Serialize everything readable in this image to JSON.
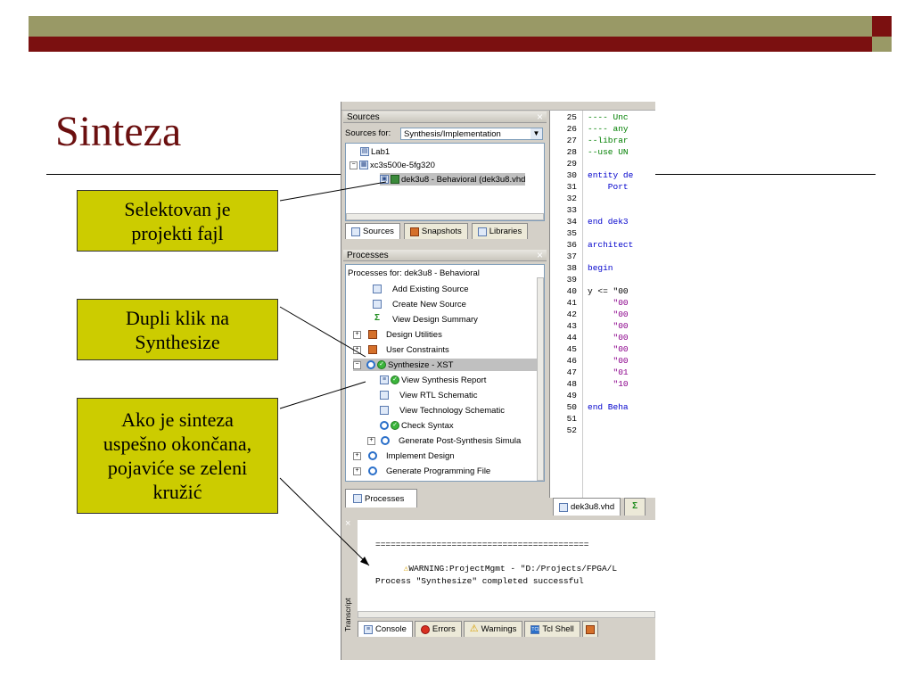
{
  "slide": {
    "title": "Sinteza",
    "callouts": [
      {
        "lines": [
          "Selektovan je",
          "projekti fajl"
        ]
      },
      {
        "lines": [
          "Dupli klik na",
          "Synthesize"
        ]
      },
      {
        "lines": [
          "Ako je sinteza",
          "uspešno okončana,",
          "pojaviće se zeleni",
          "kružić"
        ]
      }
    ]
  },
  "colors": {
    "olive": "#999966",
    "maroon": "#7b1010",
    "callout": "#cccc00",
    "title": "#6b0f0f"
  },
  "sources_panel": {
    "title": "Sources",
    "sources_for_label": "Sources for:",
    "sources_for_value": "Synthesis/Implementation",
    "tree": [
      {
        "label": "Lab1",
        "icon": "project-icon"
      },
      {
        "label": "xc3s500e-5fg320",
        "icon": "chip-icon"
      },
      {
        "label": "dek3u8 - Behavioral (dek3u8.vhd",
        "icon": "vhdl-file-icon"
      }
    ],
    "tabs": [
      {
        "label": "Sources",
        "icon": "sources-icon"
      },
      {
        "label": "Snapshots",
        "icon": "snapshots-icon"
      },
      {
        "label": "Libraries",
        "icon": "libraries-icon"
      }
    ]
  },
  "processes_panel": {
    "title": "Processes",
    "processes_for": "Processes for: dek3u8 - Behavioral",
    "items": [
      {
        "label": "Add Existing Source",
        "icon": "add-source-icon"
      },
      {
        "label": "Create New Source",
        "icon": "new-source-icon"
      },
      {
        "label": "View Design Summary",
        "icon": "sigma-icon"
      },
      {
        "label": "Design Utilities",
        "icon": "utilities-icon"
      },
      {
        "label": "User Constraints",
        "icon": "constraints-icon"
      },
      {
        "label": "Synthesize - XST",
        "icon": "green-check-icon"
      },
      {
        "label": "View Synthesis Report",
        "icon": "report-icon"
      },
      {
        "label": "View RTL Schematic",
        "icon": "schematic-icon"
      },
      {
        "label": "View Technology Schematic",
        "icon": "schematic-icon"
      },
      {
        "label": "Check Syntax",
        "icon": "green-check-icon"
      },
      {
        "label": "Generate Post-Synthesis Simula",
        "icon": "process-icon"
      },
      {
        "label": "Implement Design",
        "icon": "process-icon"
      },
      {
        "label": "Generate Programming File",
        "icon": "process-icon"
      }
    ],
    "tab": "Processes"
  },
  "editor": {
    "lines": [
      {
        "n": "25",
        "t": "---- Unc"
      },
      {
        "n": "26",
        "t": "---- any"
      },
      {
        "n": "27",
        "t": "--librar"
      },
      {
        "n": "28",
        "t": "--use UN"
      },
      {
        "n": "29",
        "t": ""
      },
      {
        "n": "30",
        "t": "entity de"
      },
      {
        "n": "31",
        "t": "    Port"
      },
      {
        "n": "32",
        "t": ""
      },
      {
        "n": "33",
        "t": ""
      },
      {
        "n": "34",
        "t": "end dek3"
      },
      {
        "n": "35",
        "t": ""
      },
      {
        "n": "36",
        "t": "architect"
      },
      {
        "n": "37",
        "t": ""
      },
      {
        "n": "38",
        "t": "begin"
      },
      {
        "n": "39",
        "t": ""
      },
      {
        "n": "40",
        "t": "y <= \"00"
      },
      {
        "n": "41",
        "t": "     \"00"
      },
      {
        "n": "42",
        "t": "     \"00"
      },
      {
        "n": "43",
        "t": "     \"00"
      },
      {
        "n": "44",
        "t": "     \"00"
      },
      {
        "n": "45",
        "t": "     \"00"
      },
      {
        "n": "46",
        "t": "     \"00 "
      },
      {
        "n": "47",
        "t": "     \"01"
      },
      {
        "n": "48",
        "t": "     \"10"
      },
      {
        "n": "49",
        "t": ""
      },
      {
        "n": "50",
        "t": "end Beha"
      },
      {
        "n": "51",
        "t": ""
      },
      {
        "n": "52",
        "t": ""
      }
    ],
    "tab": "dek3u8.vhd"
  },
  "console": {
    "separator": "==========================================",
    "warning": "WARNING:ProjectMgmt - \"D:/Projects/FPGA/L",
    "message": "Process \"Synthesize\" completed successful",
    "side_label": "Transcript",
    "tabs": [
      {
        "label": "Console",
        "icon": "console-icon"
      },
      {
        "label": "Errors",
        "icon": "error-icon"
      },
      {
        "label": "Warnings",
        "icon": "warning-icon"
      },
      {
        "label": "Tcl Shell",
        "icon": "tcl-icon"
      }
    ]
  }
}
